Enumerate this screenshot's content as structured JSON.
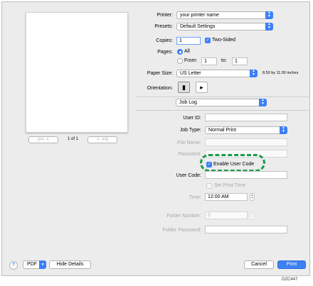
{
  "preview": {
    "page_indicator": "1 of 1",
    "nav_first": "|<<",
    "nav_prev": "<",
    "nav_next": ">",
    "nav_last": ">>|"
  },
  "printer": {
    "label": "Printer:",
    "value": "your printer name"
  },
  "presets": {
    "label": "Presets:",
    "value": "Default Settings"
  },
  "copies": {
    "label": "Copies:",
    "value": "1",
    "two_sided_label": "Two-Sided",
    "two_sided_checked": true
  },
  "pages": {
    "label": "Pages:",
    "all_label": "All",
    "from_label": "From:",
    "from_value": "1",
    "to_label": "to:",
    "to_value": "1",
    "selected": "All"
  },
  "paper_size": {
    "label": "Paper Size:",
    "value": "US Letter",
    "dimensions": "8.50 by 11.00 inches"
  },
  "orientation": {
    "label": "Orientation:",
    "selected": "portrait"
  },
  "section": {
    "value": "Job Log"
  },
  "job": {
    "user_id_label": "User ID:",
    "user_id_value": "",
    "job_type_label": "Job Type:",
    "job_type_value": "Normal Print",
    "file_name_label": "File Name:",
    "password_label": "Password:",
    "enable_user_code_label": "Enable User Code",
    "enable_user_code_checked": true,
    "user_code_label": "User Code:",
    "set_print_time_label": "Set Print Time",
    "time_label": "Time:",
    "time_value": "12:00 AM",
    "folder_number_label": "Folder Number:",
    "folder_number_value": "0",
    "folder_password_label": "Folder Password:"
  },
  "footer": {
    "help": "?",
    "pdf": "PDF",
    "hide_details": "Hide Details",
    "cancel": "Cancel",
    "print": "Print"
  },
  "figure_code": "DZC447",
  "colors": {
    "accent": "#3d7ff5",
    "highlight_dash": "#1b9a4b"
  }
}
